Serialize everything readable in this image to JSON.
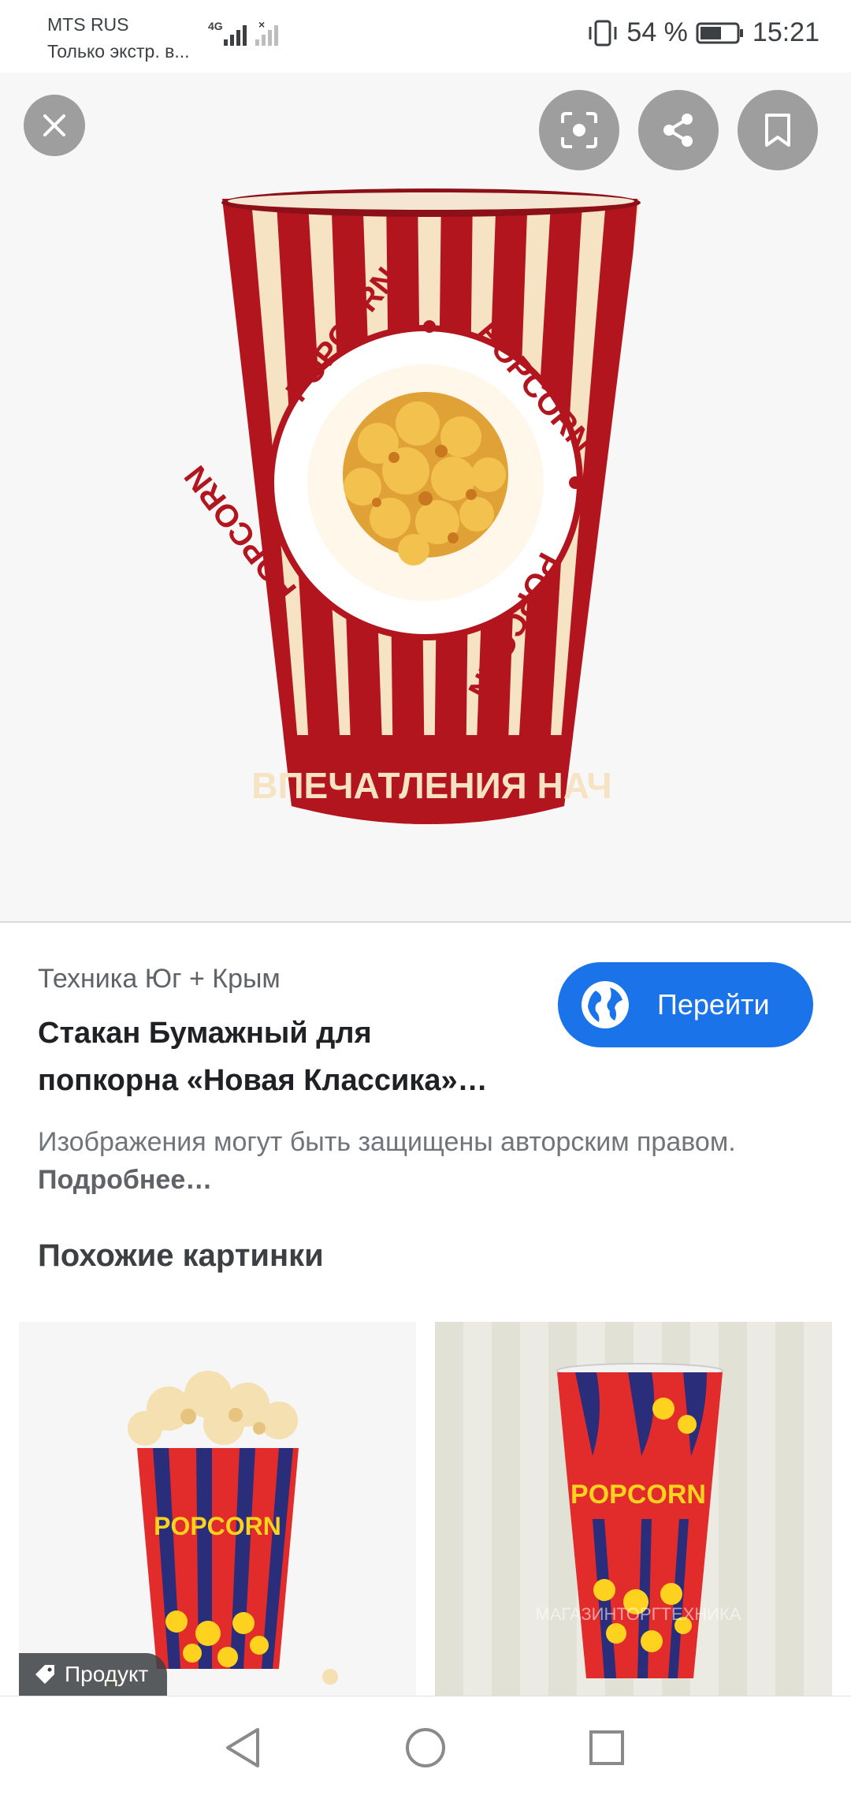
{
  "status_bar": {
    "carrier": "MTS RUS",
    "carrier_note": "Только экстр. в...",
    "network": "4G",
    "battery": "54 %",
    "time": "15:21"
  },
  "hero": {
    "cup_text_top": "POPCORN",
    "cup_text_bottom": "ВПЕЧАТЛЕНИЯ НАЧ",
    "close_icon": "close-icon",
    "lens_icon": "lens-icon",
    "share_icon": "share-icon",
    "bookmark_icon": "bookmark-icon"
  },
  "result": {
    "source": "Техника Юг + Крым",
    "title_line1": "Стакан Бумажный для",
    "title_line2": "попкорна «Новая Классика»…",
    "visit_label": "Перейти",
    "copyright_text": "Изображения могут быть защищены авторским правом.",
    "copyright_link": "Подробнее…"
  },
  "similar": {
    "heading": "Похожие картинки",
    "items": [
      {
        "cup_text": "POPCORN",
        "tag": "Продукт"
      },
      {
        "cup_text": "POPCORN",
        "watermark": "МАГАЗИНТОРГТЕХНИКА"
      }
    ]
  },
  "nav": {
    "back_icon": "back-icon",
    "home_icon": "home-icon",
    "recents_icon": "recents-icon"
  },
  "colors": {
    "accent": "#1a73e8",
    "cup_red": "#b3151f",
    "cup_cream": "#f6e3c3"
  }
}
